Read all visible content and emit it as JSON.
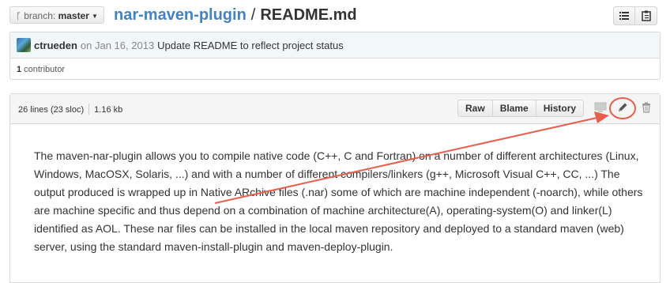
{
  "header": {
    "branch_label": "branch:",
    "branch_value": "master",
    "repo_name": "nar-maven-plugin",
    "separator": "/",
    "file_name": "README.md",
    "buttons": [
      "list-icon",
      "clipboard-icon"
    ]
  },
  "commit": {
    "author": "ctrueden",
    "date": "on Jan 16, 2013",
    "message": "Update README to reflect project status",
    "contributors_count": "1",
    "contributors_label": "contributor"
  },
  "file": {
    "lines": "26 lines (23 sloc)",
    "size": "1.16 kb",
    "buttons": {
      "raw": "Raw",
      "blame": "Blame",
      "history": "History"
    },
    "icons": [
      "desktop-icon",
      "pencil-icon",
      "trash-icon"
    ]
  },
  "readme": {
    "paragraph": "The maven-nar-plugin allows you to compile native code (C++, C and Fortran) on a number of different architectures (Linux, Windows, MacOSX, Solaris, ...) and with a number of different compilers/linkers (g++, Microsoft Visual C++, CC, ...) The output produced is wrapped up in Native ARchive files (.nar) some of which are machine independent (-noarch), while others are machine specific and thus depend on a combination of machine architecture(A), operating-system(O) and linker(L) identified as AOL. These nar files can be installed in the local maven repository and deployed to a standard maven (web) server, using the standard maven-install-plugin and maven-deploy-plugin."
  },
  "colors": {
    "link": "#4183c4",
    "annotation": "#e8604c",
    "commit_bg": "#f2f8fa"
  }
}
